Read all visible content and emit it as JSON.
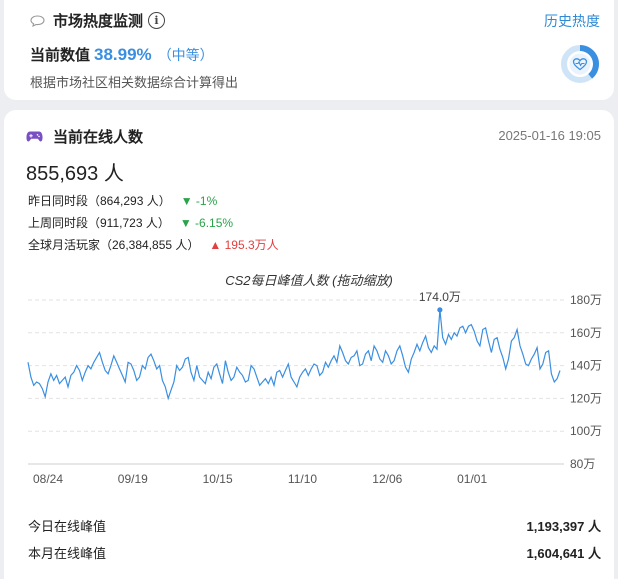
{
  "heat": {
    "title": "市场热度监测",
    "info_icon": "info-icon",
    "history_link": "历史热度",
    "current_label": "当前数值",
    "current_value": "38.99%",
    "current_level": "（中等）",
    "description": "根据市场社区相关数据综合计算得出",
    "gauge_fraction": 0.3899
  },
  "online": {
    "title": "当前在线人数",
    "timestamp": "2025-01-16 19:05",
    "count": "855,693 人",
    "compare": [
      {
        "label": "昨日同时段（864,293 人）",
        "change": "▼ -1%",
        "dir": "down"
      },
      {
        "label": "上周同时段（911,723 人）",
        "change": "▼ -6.15%",
        "dir": "down"
      },
      {
        "label": "全球月活玩家（26,384,855 人）",
        "change": "▲ 195.3万人",
        "dir": "up"
      }
    ],
    "peaks": [
      {
        "label": "今日在线峰值",
        "value": "1,193,397 人"
      },
      {
        "label": "本月在线峰值",
        "value": "1,604,641 人"
      }
    ]
  },
  "colors": {
    "accent": "#3b8fe0",
    "down": "#2aa34a",
    "up": "#e04040"
  },
  "chart_data": {
    "type": "line",
    "title": "CS2每日峰值人数 (拖动缩放)",
    "x_tick_labels": [
      "08/24",
      "09/19",
      "10/15",
      "11/10",
      "12/06",
      "01/01"
    ],
    "y_tick_labels": [
      "80万",
      "100万",
      "120万",
      "140万",
      "160万",
      "180万"
    ],
    "ylim": [
      80,
      180
    ],
    "y_unit": "万",
    "grid": true,
    "annotation": {
      "label": "174.0万",
      "value": 174.0
    },
    "series": [
      {
        "values": [
          142,
          133,
          128,
          130,
          129,
          126,
          121,
          130,
          135,
          131,
          134,
          129,
          131,
          133,
          127,
          134,
          136,
          140,
          137,
          131,
          136,
          140,
          138,
          142,
          145,
          148,
          142,
          137,
          135,
          140,
          146,
          142,
          138,
          134,
          130,
          142,
          141,
          137,
          131,
          133,
          140,
          138,
          145,
          147,
          143,
          138,
          140,
          131,
          127,
          120,
          125,
          130,
          140,
          137,
          139,
          144,
          145,
          136,
          131,
          140,
          133,
          131,
          129,
          136,
          132,
          139,
          141,
          135,
          129,
          143,
          136,
          131,
          133,
          139,
          136,
          134,
          130,
          131,
          140,
          138,
          133,
          128,
          130,
          132,
          129,
          133,
          128,
          136,
          137,
          133,
          137,
          141,
          133,
          130,
          127,
          133,
          136,
          138,
          134,
          138,
          141,
          140,
          134,
          136,
          142,
          139,
          143,
          146,
          142,
          152,
          148,
          143,
          141,
          145,
          146,
          149,
          140,
          141,
          147,
          149,
          143,
          152,
          149,
          144,
          142,
          149,
          146,
          141,
          143,
          149,
          152,
          146,
          139,
          136,
          144,
          148,
          153,
          149,
          154,
          158,
          151,
          148,
          152,
          150,
          174,
          157,
          153,
          159,
          156,
          160,
          158,
          163,
          164,
          160,
          164,
          165,
          161,
          155,
          152,
          162,
          163,
          155,
          148,
          156,
          157,
          150,
          145,
          138,
          144,
          155,
          157,
          162,
          152,
          147,
          141,
          140,
          144,
          147,
          151,
          138,
          141,
          148,
          149,
          135,
          130,
          132,
          137
        ]
      }
    ]
  }
}
